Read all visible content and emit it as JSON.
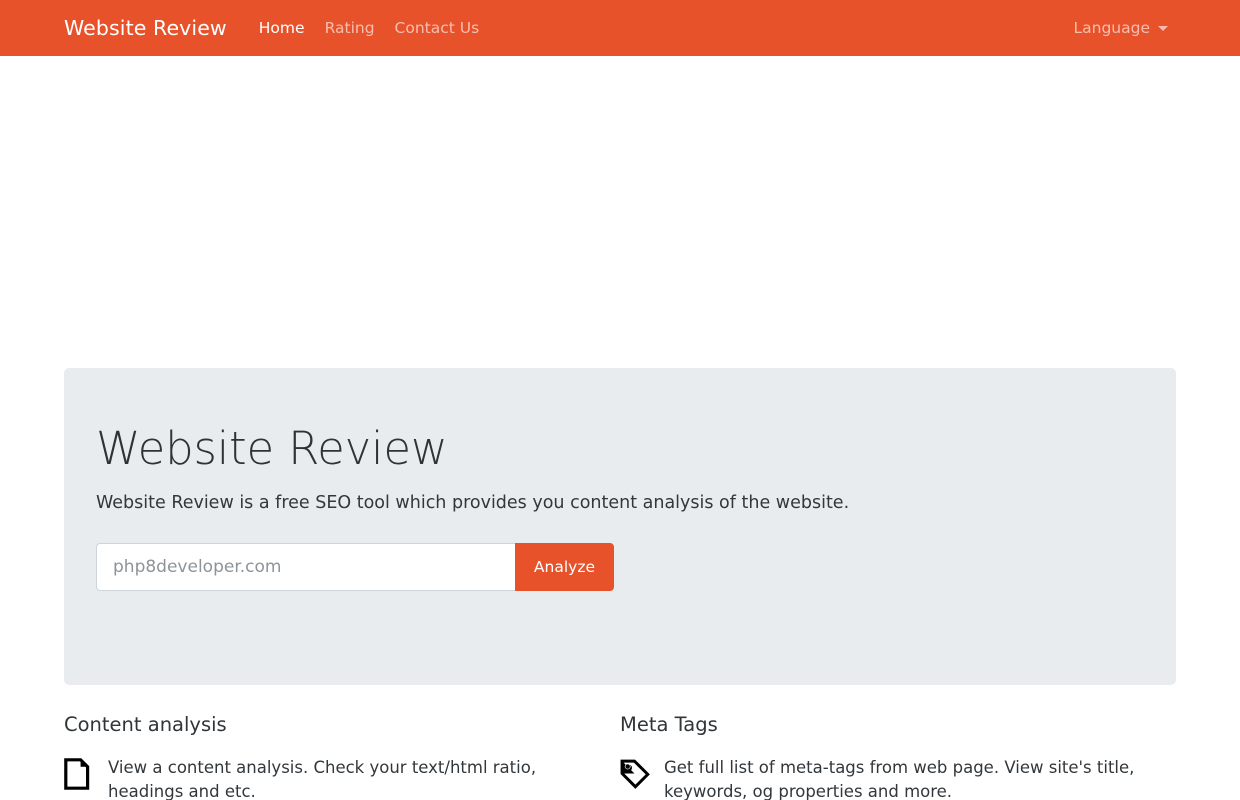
{
  "navbar": {
    "brand": "Website Review",
    "links": [
      {
        "label": "Home",
        "active": true
      },
      {
        "label": "Rating",
        "active": false
      },
      {
        "label": "Contact Us",
        "active": false
      }
    ],
    "language_toggle": "Language",
    "caret_icon": "chevron-down-icon",
    "background_color": "#e8522b"
  },
  "hero": {
    "title": "Website Review",
    "subtitle": "Website Review is a free SEO tool which provides you content analysis of the website.",
    "input_placeholder": "php8developer.com",
    "input_value": "",
    "analyze_label": "Analyze",
    "background_color": "#e9ecef",
    "button_color": "#e8522b"
  },
  "features": [
    {
      "heading": "Content analysis",
      "icon": "file-document-icon",
      "text": "View a content analysis. Check your text/html ratio, headings and etc."
    },
    {
      "heading": "Meta Tags",
      "icon": "price-tag-icon",
      "text": "Get full list of meta-tags from web page. View site's title, keywords, og properties and more."
    }
  ]
}
